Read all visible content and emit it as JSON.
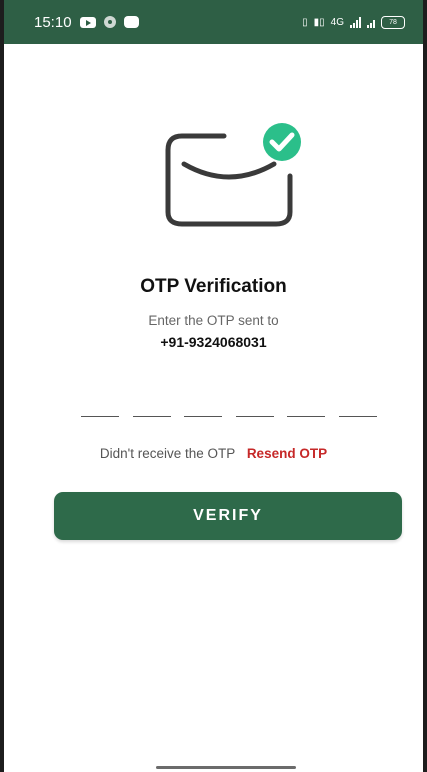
{
  "status_bar": {
    "time": "15:10",
    "right_text": "4G",
    "battery": "78",
    "background_color": "#2e5f45"
  },
  "illustration": {
    "icon": "envelope-check-icon",
    "check_color": "#2bbf8a"
  },
  "otp_screen": {
    "title": "OTP Verification",
    "subtitle": "Enter the OTP sent to",
    "phone_number": "+91-9324068031",
    "otp_digits": [
      "",
      "",
      "",
      "",
      "",
      ""
    ],
    "resend_prompt": "Didn't receive the OTP",
    "resend_label": "Resend OTP",
    "verify_label": "VERIFY"
  },
  "colors": {
    "primary": "#2e6a4a",
    "resend": "#c62828"
  }
}
